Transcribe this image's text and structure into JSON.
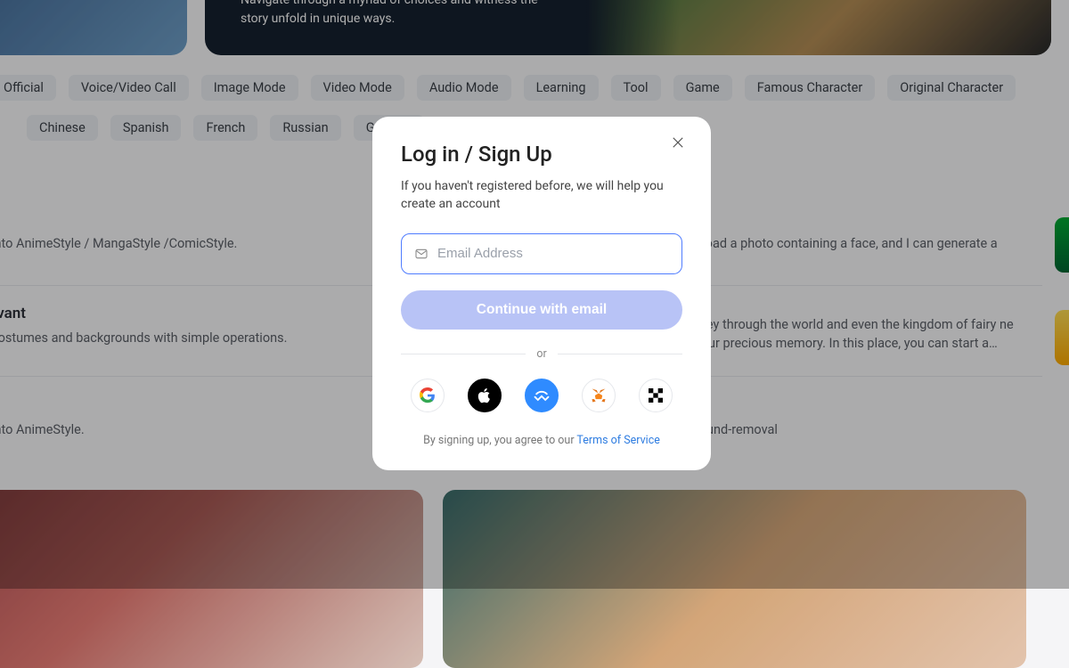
{
  "hero": {
    "description": "Navigate through a myriad of choices and witness the story unfold in unique ways."
  },
  "tags_row1": [
    "Official",
    "Voice/Video Call",
    "Image Mode",
    "Video Mode",
    "Audio Mode",
    "Learning",
    "Tool",
    "Game",
    "Famous Character",
    "Original Character"
  ],
  "tags_row2": [
    "Chinese",
    "Spanish",
    "French",
    "Russian",
    "German"
  ],
  "desc1_left": "into AnimeStyle / MangaStyle /ComicStyle.",
  "desc1_right": "pload a photo containing a face, and I can generate a",
  "desc2_title": "rvant",
  "desc2_left": "costumes and backgrounds with simple operations.",
  "desc2_right": "rney through the world and even the kingdom of fairy ne your precious memory. In this place, you can start a…",
  "desc3_left": "into AnimeStyle.",
  "desc3_right": "round-removal",
  "modal": {
    "title": "Log in / Sign Up",
    "subtitle": "If you haven't registered before, we will help you create an account",
    "email_placeholder": "Email Address",
    "continue_label": "Continue with email",
    "or_label": "or",
    "terms_prefix": "By signing up, you agree to our ",
    "terms_link": "Terms of Service"
  }
}
